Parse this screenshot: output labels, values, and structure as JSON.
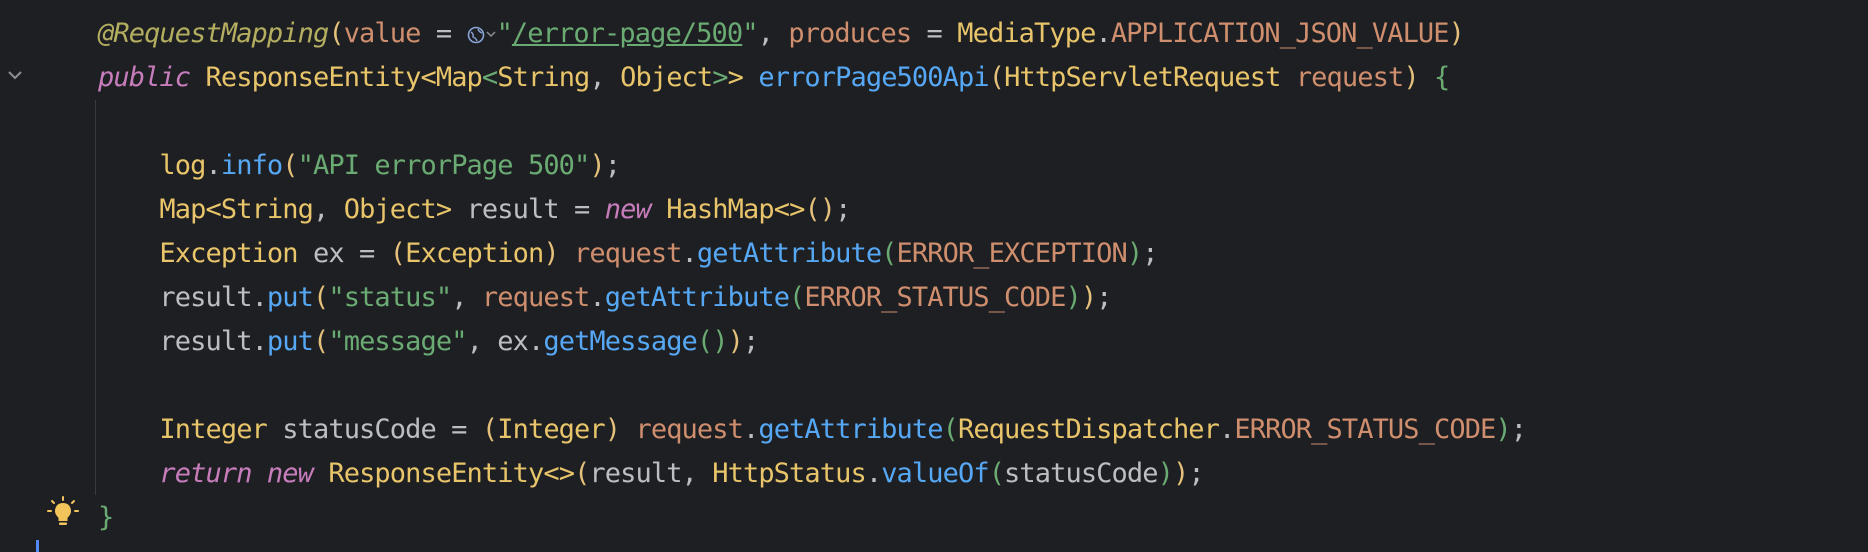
{
  "editor": {
    "language": "java",
    "lines": [
      {
        "parts": [
          {
            "t": "@RequestMapping",
            "c": "ann"
          },
          {
            "t": "(",
            "c": "paren-y"
          },
          {
            "t": "value",
            "c": "orange"
          },
          {
            "t": " = ",
            "c": "plain"
          },
          {
            "t": "GLOBE",
            "c": "globe"
          },
          {
            "t": "\"",
            "c": "str"
          },
          {
            "t": "/error-page/500",
            "c": "url"
          },
          {
            "t": "\"",
            "c": "str"
          },
          {
            "t": ", ",
            "c": "plain"
          },
          {
            "t": "produces",
            "c": "orange"
          },
          {
            "t": " = ",
            "c": "plain"
          },
          {
            "t": "MediaType",
            "c": "ytype"
          },
          {
            "t": ".",
            "c": "plain"
          },
          {
            "t": "APPLICATION_JSON_VALUE",
            "c": "orange"
          },
          {
            "t": ")",
            "c": "paren-y"
          }
        ]
      },
      {
        "parts": [
          {
            "t": "public",
            "c": "kwi"
          },
          {
            "t": " ",
            "c": "plain"
          },
          {
            "t": "ResponseEntity",
            "c": "ytype"
          },
          {
            "t": "<",
            "c": "ytype"
          },
          {
            "t": "Map",
            "c": "ytype"
          },
          {
            "t": "<",
            "c": "paren-g"
          },
          {
            "t": "String",
            "c": "ytype"
          },
          {
            "t": ", ",
            "c": "plain"
          },
          {
            "t": "Object",
            "c": "ytype"
          },
          {
            "t": ">",
            "c": "paren-g"
          },
          {
            "t": ">",
            "c": "ytype"
          },
          {
            "t": " ",
            "c": "plain"
          },
          {
            "t": "errorPage500Api",
            "c": "fn"
          },
          {
            "t": "(",
            "c": "paren-y"
          },
          {
            "t": "HttpServletRequest",
            "c": "ytype"
          },
          {
            "t": " ",
            "c": "plain"
          },
          {
            "t": "request",
            "c": "orange"
          },
          {
            "t": ")",
            "c": "paren-y"
          },
          {
            "t": " ",
            "c": "plain"
          },
          {
            "t": "{",
            "c": "brace-g"
          }
        ]
      },
      {
        "parts": []
      },
      {
        "parts": [
          {
            "t": "    ",
            "c": "plain"
          },
          {
            "t": "log",
            "c": "ytype"
          },
          {
            "t": ".",
            "c": "plain"
          },
          {
            "t": "info",
            "c": "method"
          },
          {
            "t": "(",
            "c": "paren-y"
          },
          {
            "t": "\"API errorPage 500\"",
            "c": "str"
          },
          {
            "t": ")",
            "c": "paren-y"
          },
          {
            "t": ";",
            "c": "plain"
          }
        ]
      },
      {
        "parts": [
          {
            "t": "    ",
            "c": "plain"
          },
          {
            "t": "Map",
            "c": "ytype"
          },
          {
            "t": "<",
            "c": "ytype"
          },
          {
            "t": "String",
            "c": "ytype"
          },
          {
            "t": ", ",
            "c": "plain"
          },
          {
            "t": "Object",
            "c": "ytype"
          },
          {
            "t": ">",
            "c": "ytype"
          },
          {
            "t": " result = ",
            "c": "plain"
          },
          {
            "t": "new",
            "c": "kwi"
          },
          {
            "t": " ",
            "c": "plain"
          },
          {
            "t": "HashMap",
            "c": "ytype"
          },
          {
            "t": "<>",
            "c": "ytype"
          },
          {
            "t": "()",
            "c": "paren-y"
          },
          {
            "t": ";",
            "c": "plain"
          }
        ]
      },
      {
        "parts": [
          {
            "t": "    ",
            "c": "plain"
          },
          {
            "t": "Exception",
            "c": "ytype"
          },
          {
            "t": " ex = ",
            "c": "plain"
          },
          {
            "t": "(",
            "c": "paren-y"
          },
          {
            "t": "Exception",
            "c": "ytype"
          },
          {
            "t": ")",
            "c": "paren-y"
          },
          {
            "t": " ",
            "c": "plain"
          },
          {
            "t": "request",
            "c": "orange"
          },
          {
            "t": ".",
            "c": "plain"
          },
          {
            "t": "getAttribute",
            "c": "method"
          },
          {
            "t": "(",
            "c": "paren-g"
          },
          {
            "t": "ERROR_EXCEPTION",
            "c": "orange"
          },
          {
            "t": ")",
            "c": "paren-g"
          },
          {
            "t": ";",
            "c": "plain"
          }
        ]
      },
      {
        "parts": [
          {
            "t": "    ",
            "c": "plain"
          },
          {
            "t": "result",
            "c": "plain"
          },
          {
            "t": ".",
            "c": "plain"
          },
          {
            "t": "put",
            "c": "method"
          },
          {
            "t": "(",
            "c": "paren-y"
          },
          {
            "t": "\"status\"",
            "c": "str"
          },
          {
            "t": ", ",
            "c": "plain"
          },
          {
            "t": "request",
            "c": "orange"
          },
          {
            "t": ".",
            "c": "plain"
          },
          {
            "t": "getAttribute",
            "c": "method"
          },
          {
            "t": "(",
            "c": "paren-g"
          },
          {
            "t": "ERROR_STATUS_CODE",
            "c": "orange"
          },
          {
            "t": ")",
            "c": "paren-g"
          },
          {
            "t": ")",
            "c": "paren-y"
          },
          {
            "t": ";",
            "c": "plain"
          }
        ]
      },
      {
        "parts": [
          {
            "t": "    ",
            "c": "plain"
          },
          {
            "t": "result",
            "c": "plain"
          },
          {
            "t": ".",
            "c": "plain"
          },
          {
            "t": "put",
            "c": "method"
          },
          {
            "t": "(",
            "c": "paren-y"
          },
          {
            "t": "\"message\"",
            "c": "str"
          },
          {
            "t": ", ",
            "c": "plain"
          },
          {
            "t": "ex",
            "c": "plain"
          },
          {
            "t": ".",
            "c": "plain"
          },
          {
            "t": "getMessage",
            "c": "method"
          },
          {
            "t": "()",
            "c": "paren-g"
          },
          {
            "t": ")",
            "c": "paren-y"
          },
          {
            "t": ";",
            "c": "plain"
          }
        ]
      },
      {
        "parts": []
      },
      {
        "parts": [
          {
            "t": "    ",
            "c": "plain"
          },
          {
            "t": "Integer",
            "c": "ytype"
          },
          {
            "t": " statusCode = ",
            "c": "plain"
          },
          {
            "t": "(",
            "c": "paren-y"
          },
          {
            "t": "Integer",
            "c": "ytype"
          },
          {
            "t": ")",
            "c": "paren-y"
          },
          {
            "t": " ",
            "c": "plain"
          },
          {
            "t": "request",
            "c": "orange"
          },
          {
            "t": ".",
            "c": "plain"
          },
          {
            "t": "getAttribute",
            "c": "method"
          },
          {
            "t": "(",
            "c": "paren-g"
          },
          {
            "t": "RequestDispatcher",
            "c": "ytype"
          },
          {
            "t": ".",
            "c": "plain"
          },
          {
            "t": "ERROR_STATUS_CODE",
            "c": "orange"
          },
          {
            "t": ")",
            "c": "paren-g"
          },
          {
            "t": ";",
            "c": "plain"
          }
        ]
      },
      {
        "parts": [
          {
            "t": "    ",
            "c": "plain"
          },
          {
            "t": "return",
            "c": "kwi"
          },
          {
            "t": " ",
            "c": "plain"
          },
          {
            "t": "new",
            "c": "kwi"
          },
          {
            "t": " ",
            "c": "plain"
          },
          {
            "t": "ResponseEntity",
            "c": "ytype"
          },
          {
            "t": "<>",
            "c": "ytype"
          },
          {
            "t": "(",
            "c": "paren-y"
          },
          {
            "t": "result, ",
            "c": "plain"
          },
          {
            "t": "HttpStatus",
            "c": "ytype"
          },
          {
            "t": ".",
            "c": "plain"
          },
          {
            "t": "valueOf",
            "c": "method"
          },
          {
            "t": "(",
            "c": "paren-g"
          },
          {
            "t": "statusCode",
            "c": "plain"
          },
          {
            "t": ")",
            "c": "paren-g"
          },
          {
            "t": ")",
            "c": "paren-y"
          },
          {
            "t": ";",
            "c": "plain"
          }
        ]
      },
      {
        "parts": [
          {
            "t": "}",
            "c": "brace-g"
          }
        ]
      }
    ]
  },
  "gutter": {
    "fold_icon": "chevron-down-icon",
    "hint_icon": "lightbulb-icon"
  },
  "colors": {
    "background": "#1e1f22",
    "keyword": "#c77dbb",
    "type": "#e8c46a",
    "string": "#6aab73",
    "method": "#56a8f5",
    "field": "#cf8e6d",
    "annotation": "#b3ae60",
    "plain": "#bcbec4"
  }
}
